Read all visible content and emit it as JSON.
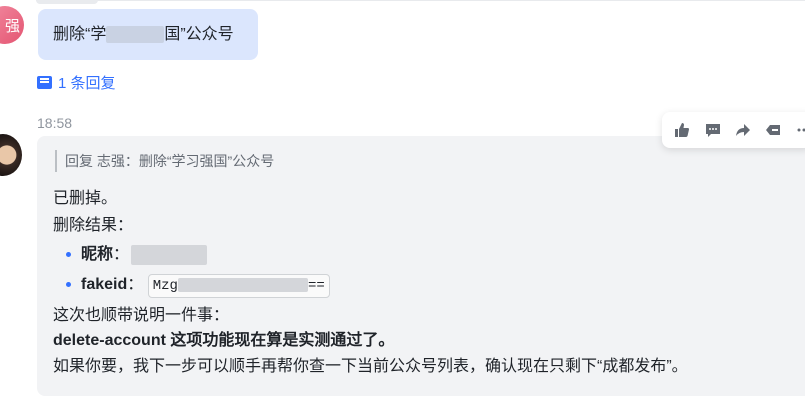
{
  "previous_message": {
    "avatar_text": "强",
    "text_start": "删除“学",
    "text_end": "国”公众号"
  },
  "thread": {
    "label": "1 条回复"
  },
  "timestamp": "18:58",
  "reply": {
    "quote": "回复 志强：删除“学习强国”公众号",
    "line1": "已删掉。",
    "line2": "删除结果：",
    "nickname_label": "昵称",
    "fakeid_label": "fakeid",
    "colon": "：",
    "fakeid_prefix": "Mzg",
    "fakeid_suffix": "==",
    "line3": "这次也顺带说明一件事：",
    "line4_bold": "delete-account 这项功能现在算是实测通过了。",
    "line5": "如果你要，我下一步可以顺手再帮你查一下当前公众号列表，确认现在只剩下“成都发布”。"
  },
  "toolbar": {
    "icons": [
      "thumbs-up-icon",
      "comment-icon",
      "forward-icon",
      "tag-icon",
      "more-icon"
    ]
  }
}
